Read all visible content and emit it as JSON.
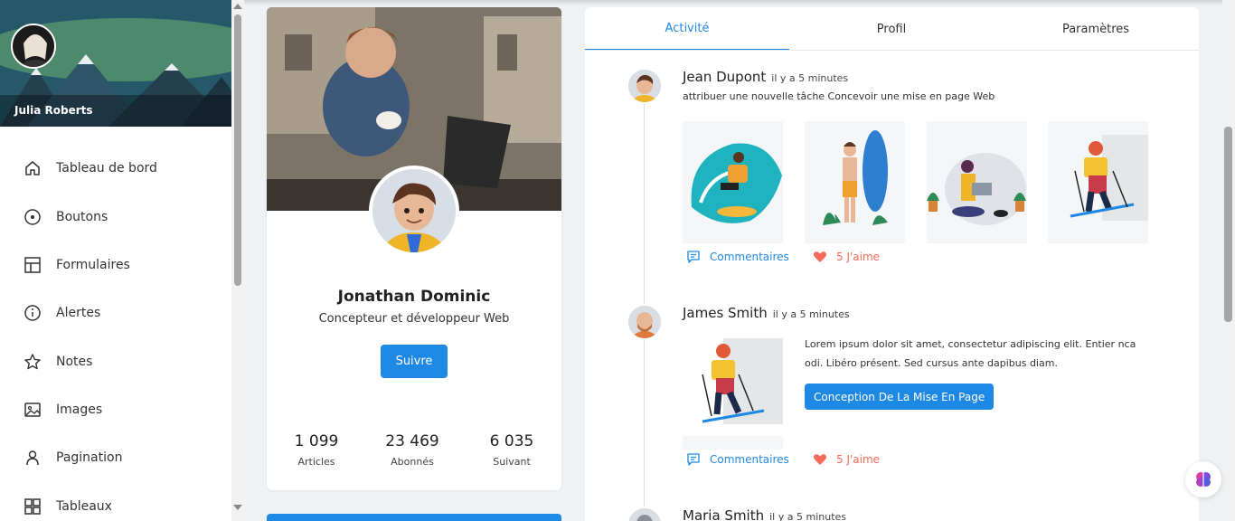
{
  "sidebar": {
    "user_name": "Julia Roberts",
    "items": [
      {
        "label": "Tableau de bord",
        "icon": "home-icon"
      },
      {
        "label": "Boutons",
        "icon": "circle-dot-icon"
      },
      {
        "label": "Formulaires",
        "icon": "table-layout-icon"
      },
      {
        "label": "Alertes",
        "icon": "info-icon"
      },
      {
        "label": "Notes",
        "icon": "star-icon"
      },
      {
        "label": "Images",
        "icon": "image-icon"
      },
      {
        "label": "Pagination",
        "icon": "user-icon"
      },
      {
        "label": "Tableaux",
        "icon": "grid-icon"
      }
    ]
  },
  "profile": {
    "name": "Jonathan Dominic",
    "role": "Concepteur et développeur Web",
    "follow_label": "Suivre",
    "stats": [
      {
        "value": "1 099",
        "label": "Articles"
      },
      {
        "value": "23 469",
        "label": "Abonnés"
      },
      {
        "value": "6 035",
        "label": "Suivant"
      }
    ]
  },
  "tabs": [
    "Activité",
    "Profil",
    "Paramètres"
  ],
  "feed": [
    {
      "name": "Jean Dupont",
      "time": "il y a 5 minutes",
      "desc": "attribuer une nouvelle tâche Concevoir une mise en page Web",
      "comments_label": "Commentaires",
      "likes_label": "5 J'aime"
    },
    {
      "name": "James Smith",
      "time": "il y a 5 minutes",
      "text": "Lorem ipsum dolor sit amet, consectetur adipiscing elit. Entier nca odi. Libéro présent. Sed cursus ante dapibus diam.",
      "button_label": "Conception De La Mise En Page",
      "comments_label": "Commentaires",
      "likes_label": "5 J'aime"
    },
    {
      "name": "Maria Smith",
      "time": "il y a 5 minutes"
    }
  ],
  "colors": {
    "accent": "#1e88e5",
    "like": "#f26b5b"
  }
}
